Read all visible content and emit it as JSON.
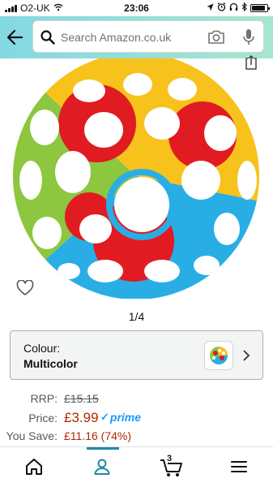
{
  "status_bar": {
    "carrier": "O2-UK",
    "time": "23:06",
    "battery_level": 0.9
  },
  "search": {
    "placeholder": "Search Amazon.co.uk"
  },
  "icons": {
    "back": "back-arrow-icon",
    "search": "search-icon",
    "camera": "camera-icon",
    "microphone": "microphone-icon",
    "share": "share-icon",
    "wishlist": "heart-icon",
    "chevron": "chevron-right-icon",
    "home": "home-icon",
    "account": "account-icon",
    "cart": "cart-icon",
    "menu": "menu-icon"
  },
  "product": {
    "image_index": "1/4",
    "colour_label": "Colour:",
    "colour_value": "Multicolor",
    "colors": [
      "#8dc63f",
      "#f7c21b",
      "#e11b22",
      "#28aee4"
    ]
  },
  "pricing": {
    "rrp_label": "RRP:",
    "rrp_value": "£15.15",
    "price_label": "Price:",
    "price_value": "£3.99",
    "prime_label": "prime",
    "save_label": "You Save:",
    "save_value": "£11.16 (74%)"
  },
  "nav": {
    "cart_count": "3",
    "active": "account"
  },
  "theme": {
    "header_gradient": [
      "#84d8e3",
      "#a6e6ce"
    ],
    "price_color": "#b12704",
    "prime_color": "#1a98ff",
    "active_nav_color": "#1d8ca3"
  }
}
